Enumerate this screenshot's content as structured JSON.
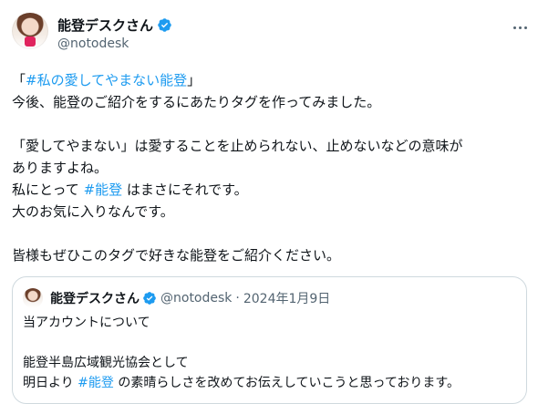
{
  "author": {
    "display_name": "能登デスクさん",
    "handle": "@notodesk"
  },
  "tweet": {
    "lines": [
      {
        "before": "「",
        "hashtag": "#私の愛してやまない能登",
        "after": "」"
      },
      {
        "text": "今後、能登のご紹介をするにあたりタグを作ってみました。"
      },
      {
        "text": ""
      },
      {
        "text": "「愛してやまない」は愛することを止められない、止めないなどの意味が"
      },
      {
        "text": "ありますよね。"
      },
      {
        "before": "私にとって ",
        "hashtag": "#能登",
        "after": " はまさにそれです。"
      },
      {
        "text": "大のお気に入りなんです。"
      },
      {
        "text": ""
      },
      {
        "text": "皆様もぜひこのタグで好きな能登をご紹介ください。"
      }
    ]
  },
  "quote": {
    "display_name": "能登デスクさん",
    "handle": "@notodesk",
    "separator": "·",
    "date": "2024年1月9日",
    "lines": [
      {
        "text": "当アカウントについて"
      },
      {
        "text": ""
      },
      {
        "text": "能登半島広域観光協会として"
      },
      {
        "before": "明日より ",
        "hashtag": "#能登",
        "after": " の素晴らしさを改めてお伝えしていこうと思っております。"
      }
    ]
  },
  "icons": {
    "verified": "verified-badge-icon",
    "more": "more-dots-icon"
  },
  "colors": {
    "link": "#1d9bf0",
    "text": "#0f1419",
    "secondary": "#536471",
    "border": "#cfd9de"
  }
}
